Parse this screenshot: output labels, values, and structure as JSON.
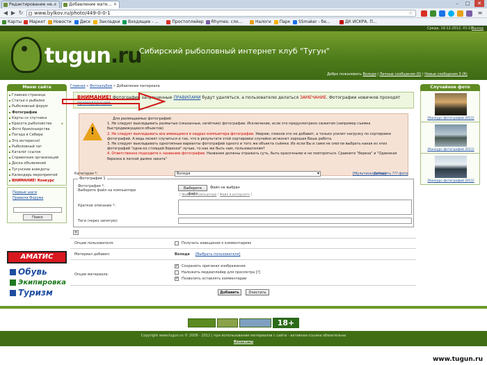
{
  "browser": {
    "tabs": [
      {
        "label": "Редактирование не..."
      },
      {
        "label": "Добавление мате..."
      }
    ],
    "url": "www.bylkov.ru/photo/449-0-0-1",
    "bookmarks": [
      "Карты",
      "Маркет",
      "Новости",
      "Диск",
      "Закладки",
      "Входящие - ...",
      "Простоплейер",
      "Rhymes: сло...",
      "Налоги",
      "Парк",
      "SSmaker - бе...",
      "ДК ИСКРА. П..."
    ],
    "bookmark_colors": [
      "#3c8d2f",
      "#d93025",
      "#e8a21a",
      "#1a73e8",
      "#f4b400",
      "#0f9d58",
      "#d93025",
      "#7b5ea7",
      "#e8a21a",
      "#f4b400",
      "#1a73e8",
      "#c00000"
    ]
  },
  "header": {
    "logo_text": "tugun",
    "logo_dot": ".ru",
    "title": "Сибирский рыболовный интернет клуб \"Тугун\"",
    "date": "Среда, 19.12.2012, 01:10",
    "logout": "Выход",
    "userbar": {
      "welcome": "Добро пожаловать",
      "user": "Володя",
      "messages": "Личные сообщения (0)",
      "new_messages": "Новые сообщения 3 (ft)"
    }
  },
  "left_menu": {
    "title": "Меню сайта",
    "items": [
      {
        "label": "Главная страница",
        "style": ""
      },
      {
        "label": "Статьи о рыбалке",
        "style": ""
      },
      {
        "label": "Рыболовный форум",
        "style": ""
      },
      {
        "label": "Фотографии",
        "style": "bold"
      },
      {
        "label": "Карты со спутника",
        "style": ""
      },
      {
        "label": "Красота рыболовства",
        "style": "",
        "arrow": "▸"
      },
      {
        "label": "Фото браконьерства",
        "style": ""
      },
      {
        "label": "Погода в Сибири",
        "style": ""
      },
      {
        "label": "Это интересно!",
        "style": ""
      },
      {
        "label": "Рыболовный чат",
        "style": ""
      },
      {
        "label": "Каталог ссылок",
        "style": ""
      },
      {
        "label": "Справочник организаций",
        "style": ""
      },
      {
        "label": "Доска объявлений",
        "style": ""
      },
      {
        "label": "Тугунские анекдоты",
        "style": ""
      },
      {
        "label": "Календарь мероприятий",
        "style": ""
      },
      {
        "label": "ВНИМАНИЕ! Конкурс",
        "style": "red"
      }
    ],
    "links": [
      "Первые шаги",
      "Правила Форума"
    ],
    "search_button": "Поиск"
  },
  "ads": {
    "amatis": "AMATИС",
    "lines": [
      "Обувь",
      "Экипировка",
      "Туризм"
    ]
  },
  "breadcrumb": {
    "home": "Главная",
    "section": "Фотоальбом",
    "current": "Добавление материала"
  },
  "warning1": {
    "attention": "ВНИМАНИЕ!",
    "text_before": " Фотографии запрещенные ",
    "rules": "ПРАВИЛАМИ",
    "text_middle": " будут удаляться, а пользователю делаться ",
    "remark": "ЗАМЕЧАНИЕ",
    "text_after": ". Фотографии новичков проходят",
    "premod": "премодерацию."
  },
  "warning2": {
    "title": "Для размещаемых фотографий:",
    "rule1": "1. Не следует выкладывать размытые (смазанные, нечёткие) фотографии. Исключение, если это предусмотрено сюжетом (например съемка быстродвижущихся объектов)",
    "rule2_red": "2. Не следует выкладывать все имеющиеся в недрах компьютера фотографии.",
    "rule2_rest": " Уверяю, плюсов это не добавит, а только усилит нагрузку по сортировке фотографий. А ведь может случиться и так, что в результате этой сортировки случайно исчезнет хорошая Ваша работа.",
    "rule3": "3. Не следует выкладывать однотипные варианты фотографий одного и того же объекта съёмки. Их если Вы и сами не смогли выбрать какая из этих фотографий \"одна-ко стоящей березки\" лучше, то как же быть нам, пользователям?",
    "rule4_red": "4. Ответственно подходите к названию фотографии.",
    "rule4_rest": " Названия должны отражать суть, быть красочными и не повторяться. Сравните \"береза\" и \"Одинокая березка в легкой дымке заката\""
  },
  "form": {
    "category_label": "Категория *:",
    "category_value": "Володя",
    "multiselect": "Мультиселектор",
    "add_many": "Добавить ??? фото",
    "fieldset_legend": "Фотография 1",
    "photo_label": "Фотография *:",
    "photo_hint": "Выберите файл на компьютере",
    "file_button": "Выберите файл",
    "file_status": "Файл не выбран",
    "link_line_prefix": "[ ",
    "link_computer": "Файл на компьютере",
    "link_internet": "Файл в интернете",
    "link_line_suffix": " ]",
    "short_desc_label": "Краткое описание *:",
    "tags_label": "Теги (через запятую):",
    "add_photo_button": "+",
    "options_user_label": "Опции пользователя:",
    "notify_label": "Получать извещения о комментариях",
    "author_label": "Материал добавил:",
    "author_name": "Володя",
    "change_user": "[Выбрать пользователя]",
    "material_options_label": "Опции материала:",
    "opt_keep_original": "Сохранить оригинал изображения",
    "opt_no_preview": "Наложить медиаплейер для просмотра [?]",
    "opt_allow_comments": "Позволить оставлять комментарии",
    "submit_button": "Добавить",
    "reset_button": "Очистить"
  },
  "right": {
    "title": "Случайное фото",
    "photos": [
      {
        "caption": "[Конкурс фотографий 2011]"
      },
      {
        "caption": "[Конкурс фотографий 2011]"
      },
      {
        "caption": "[Конкурс фотографий 2011]"
      }
    ]
  },
  "footer": {
    "age": "18+",
    "copyright": "Copyright www.tugun.ru © 2008 - 2012 | при использовании материалов с сайта - активная ссылка обязательна",
    "contacts": "Контакты",
    "watermark": "www.tugun.ru"
  }
}
